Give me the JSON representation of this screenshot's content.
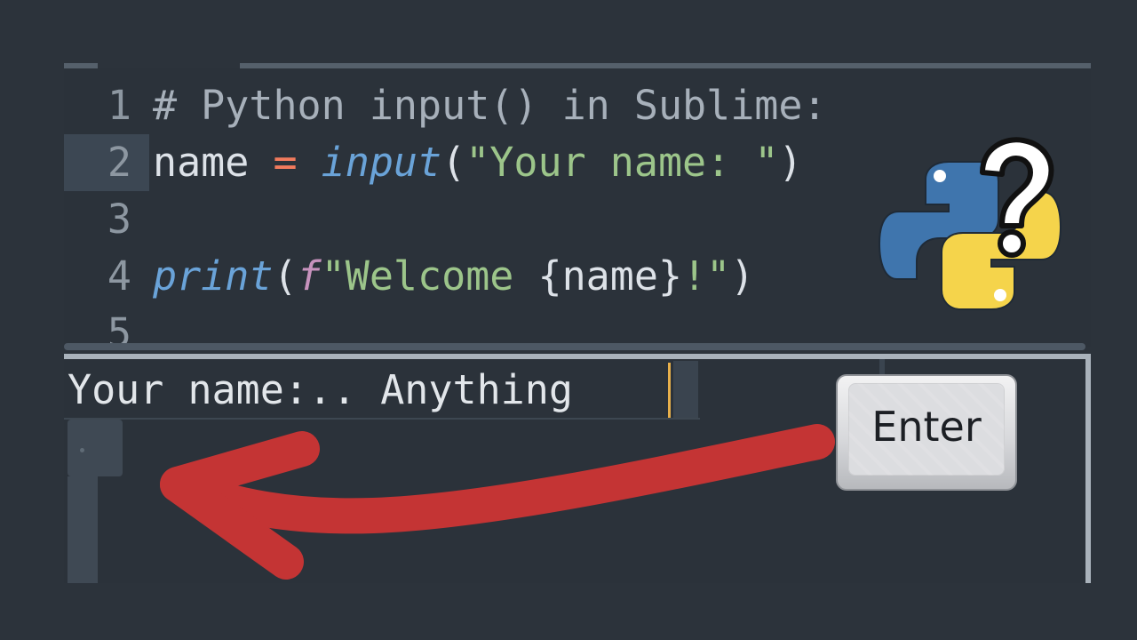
{
  "editor": {
    "lines": [
      {
        "number": "1",
        "tokens": {
          "comment": "# Python input() in Sublime:"
        }
      },
      {
        "number": "2",
        "tokens": {
          "var": "name",
          "op": " = ",
          "fn": "input",
          "open": "(",
          "str": "\"Your name: \"",
          "close": ")"
        }
      },
      {
        "number": "3"
      },
      {
        "number": "4",
        "tokens": {
          "fn": "print",
          "open": "(",
          "prefix": "f",
          "str": "\"Welcome ",
          "braces": "{name}",
          "str2": "!\"",
          "close": ")"
        }
      },
      {
        "number": "5"
      }
    ]
  },
  "console": {
    "input_text": "Your name:.. Anything"
  },
  "overlay": {
    "enter_key_label": "Enter",
    "arrow_color": "#c43434",
    "icons": [
      "python-logo-icon",
      "question-mark-icon",
      "enter-key-icon",
      "red-arrow-icon"
    ]
  },
  "colors": {
    "background": "#2c333b",
    "comment": "#a7b0ba",
    "operator": "#f27b5d",
    "function": "#6aa3d8",
    "string": "#9cc58a",
    "caret": "#e8b04b"
  }
}
